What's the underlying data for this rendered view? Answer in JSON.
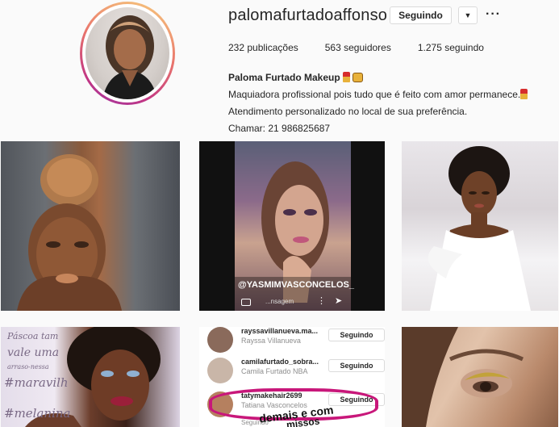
{
  "profile": {
    "username": "palomafurtadoaffonso",
    "follow_label": "Seguindo",
    "dropdown_glyph": "▼",
    "more_glyph": "···",
    "stats": {
      "posts_count": "232",
      "posts_label": "publicações",
      "followers_count": "563",
      "followers_label": "seguidores",
      "following_count": "1.275",
      "following_label": "seguindo"
    },
    "bio": {
      "name": "Paloma Furtado Makeup",
      "line1": "Maquiadora profissional pois tudo que é feito com amor permanece.",
      "line2": "Atendimento personalizado no local de sua preferência.",
      "line3": "Chamar: 21 986825687"
    }
  },
  "posts": {
    "post2": {
      "watermark": "@YASMIMVASCONCELOS_",
      "message_hint": "...nsagem"
    },
    "post4": {
      "line1": "Páscoa tam",
      "line2": "vale uma",
      "line3": "arraso-nessa",
      "line4": "#maravilh",
      "line5": "#melanina"
    },
    "post5": {
      "rows": [
        {
          "username": "rayssavillanueva.ma...",
          "fullname": "Rayssa Villanueva",
          "button": "Seguindo"
        },
        {
          "username": "camilafurtado_sobra...",
          "fullname": "Camila Furtado NBA",
          "button": "Seguindo"
        },
        {
          "username": "tatymakehair2699",
          "fullname": "Tatiana Vasconcelos",
          "button": "Seguindo"
        }
      ],
      "overlay": "demais e com",
      "overlay2": "missos",
      "partial": "Seguindo"
    }
  },
  "colors": {
    "ring_start": "#f7ce7d",
    "ring_end": "#9a39a8",
    "highlight": "#c8177a"
  }
}
